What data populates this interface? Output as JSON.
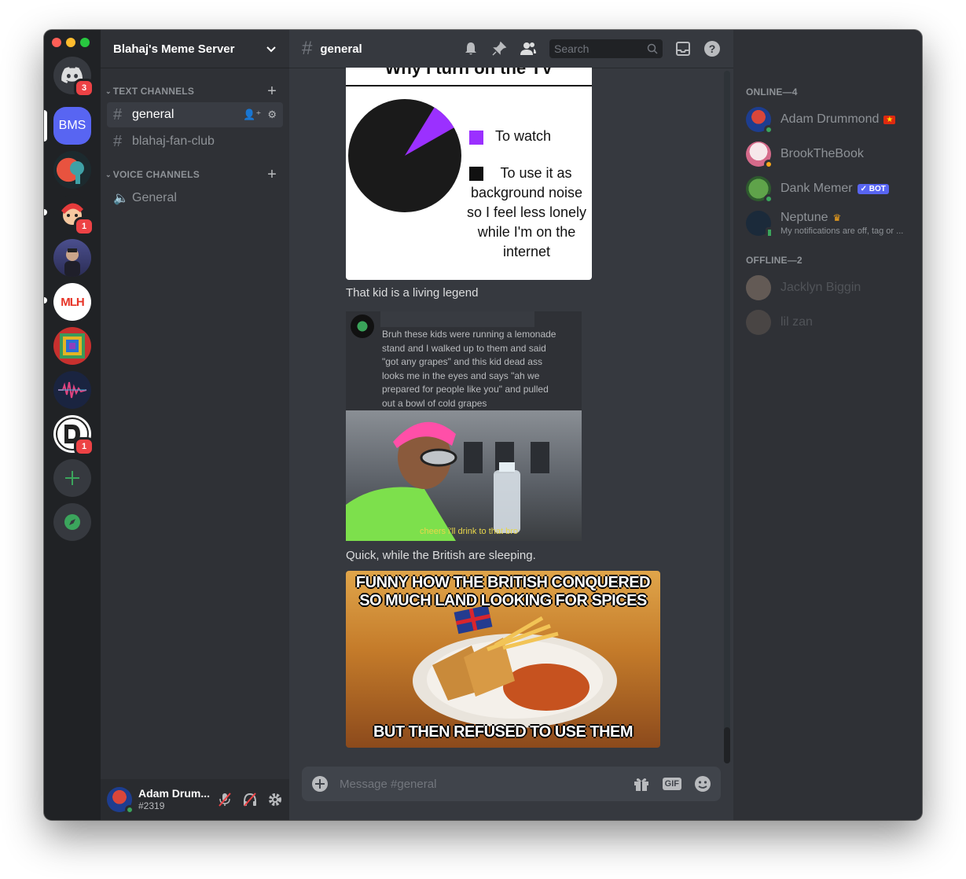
{
  "rail": {
    "home_badge": "3",
    "bms_label": "BMS",
    "server_badges": [
      "1",
      "1"
    ],
    "mlh_label": "MLH",
    "colors": {
      "blurple": "#5865f2",
      "green": "#3ba55c",
      "red": "#ed4245"
    }
  },
  "sidebar": {
    "guild_name": "Blahaj's Meme Server",
    "text_category": "TEXT CHANNELS",
    "voice_category": "VOICE CHANNELS",
    "text_channels": [
      "general",
      "blahaj-fan-club"
    ],
    "voice_channels": [
      "General"
    ]
  },
  "user": {
    "name": "Adam Drum...",
    "tag": "#2319"
  },
  "topbar": {
    "channel": "general",
    "search_placeholder": "Search"
  },
  "messages": {
    "meme1": {
      "title": "Why I turn on the TV",
      "legend_watch": "To watch",
      "legend_noise_lines": [
        "To use it as",
        "background noise",
        "so I feel less lonely",
        "while I'm on the",
        "internet"
      ],
      "purple_fraction": 0.08
    },
    "text1": "That kid is a living legend",
    "meme2": {
      "post_lines": [
        "Bruh these kids were running a lemonade",
        "stand and I walked up to them and said",
        "\"got any grapes\" and this kid dead ass",
        "looks me in the eyes and says \"ah we",
        "prepared for people like you\" and pulled",
        "out a bowl of cold grapes"
      ],
      "caption": "cheers i'll drink to that bro"
    },
    "text2": "Quick, while the British are sleeping.",
    "meme3": {
      "top_lines": [
        "FUNNY HOW THE BRITISH CONQUERED",
        "SO MUCH LAND LOOKING FOR SPICES"
      ],
      "bottom": "BUT THEN REFUSED TO USE THEM"
    }
  },
  "composer": {
    "placeholder": "Message #general",
    "gif": "GIF"
  },
  "members": {
    "online_header": "ONLINE—4",
    "offline_header": "OFFLINE—2",
    "online": [
      {
        "name": "Adam Drummond"
      },
      {
        "name": "BrookTheBook"
      },
      {
        "name": "Dank Memer",
        "tag": "BOT"
      },
      {
        "name": "Neptune",
        "status": "My notifications are off, tag or ..."
      }
    ],
    "offline": [
      {
        "name": "Jacklyn Biggin"
      },
      {
        "name": "lil zan"
      }
    ]
  }
}
